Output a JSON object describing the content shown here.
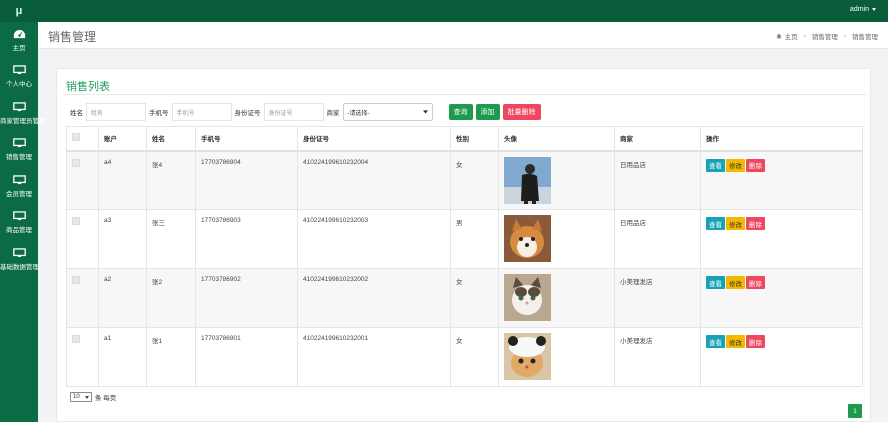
{
  "topbar": {
    "logo": "μ",
    "user": "admin"
  },
  "sidebar": {
    "items": [
      {
        "label": "主页",
        "icon": "dashboard-icon"
      },
      {
        "label": "个人中心",
        "icon": "monitor-icon"
      },
      {
        "label": "商家管理员管理",
        "icon": "monitor-icon"
      },
      {
        "label": "销售管理",
        "icon": "monitor-icon"
      },
      {
        "label": "会员管理",
        "icon": "monitor-icon"
      },
      {
        "label": "商品管理",
        "icon": "monitor-icon"
      },
      {
        "label": "基础数据管理",
        "icon": "monitor-icon"
      }
    ]
  },
  "header": {
    "title": "销售管理",
    "breadcrumb": [
      "主页",
      "销售管理",
      "销售管理"
    ]
  },
  "card": {
    "title": "销售列表",
    "filters": {
      "name_label": "姓名",
      "name_placeholder": "姓名",
      "phone_label": "手机号",
      "phone_placeholder": "手机号",
      "id_label": "身份证号",
      "id_placeholder": "身份证号",
      "merchant_label": "商家",
      "merchant_value": "-请选择-",
      "query": "查询",
      "add": "添加",
      "batch_delete": "批量删除"
    },
    "columns": [
      "",
      "账户",
      "姓名",
      "手机号",
      "身份证号",
      "性别",
      "头像",
      "商家",
      "操作"
    ],
    "rows": [
      {
        "account": "a4",
        "name": "张4",
        "phone": "17703786904",
        "idcard": "410224199610232004",
        "gender": "女",
        "avatar": "person",
        "merchant": "日用品店"
      },
      {
        "account": "a3",
        "name": "张三",
        "phone": "17703786903",
        "idcard": "410224199610232003",
        "gender": "男",
        "avatar": "dog",
        "merchant": "日用品店"
      },
      {
        "account": "a2",
        "name": "张2",
        "phone": "17703786902",
        "idcard": "410224199610232002",
        "gender": "女",
        "avatar": "cat",
        "merchant": "小美理发店"
      },
      {
        "account": "a1",
        "name": "张1",
        "phone": "17703786901",
        "idcard": "410224199610232001",
        "gender": "女",
        "avatar": "cat-hat",
        "merchant": "小美理发店"
      }
    ],
    "actions": {
      "view": "查看",
      "edit": "修改",
      "delete": "删除"
    },
    "pager": {
      "size": "10",
      "size_suffix": "条 每页",
      "current": "1"
    }
  },
  "colors": {
    "topbar": "#0a5d3b",
    "sidebar": "#0a6b44",
    "accent": "#1e9a4e",
    "danger": "#ef4760",
    "info": "#18a2b8",
    "warning": "#f5b800"
  }
}
